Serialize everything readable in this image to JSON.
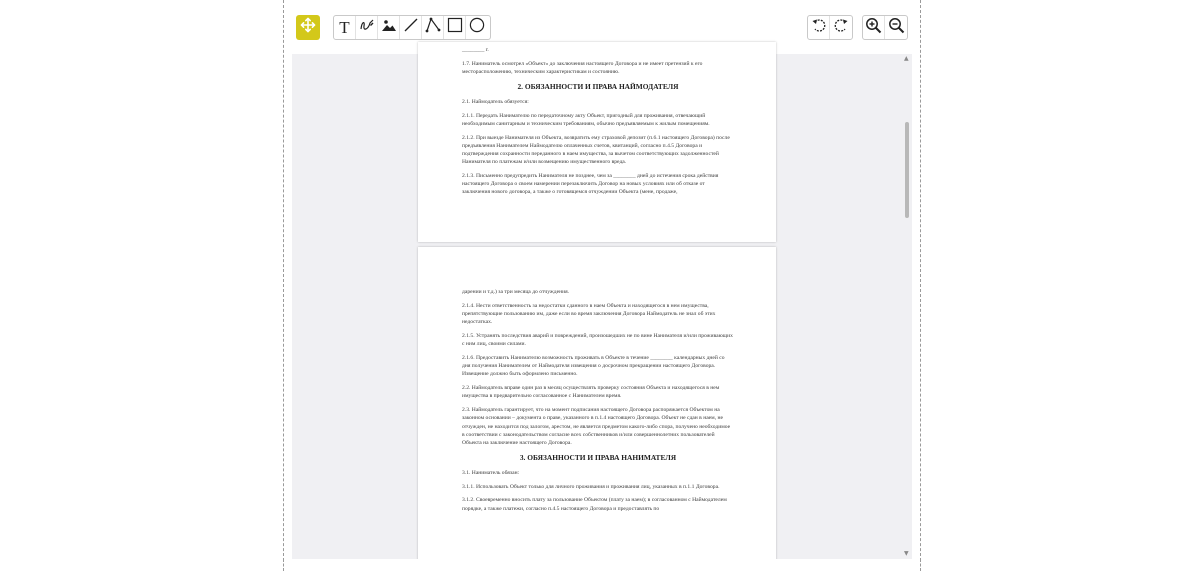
{
  "toolbar": {
    "move_tool": "move-icon",
    "tools": [
      "text-icon",
      "freehand-icon",
      "image-icon",
      "line-icon",
      "polyline-icon",
      "rectangle-icon",
      "circle-icon"
    ],
    "rotate": [
      "rotate-left-icon",
      "rotate-right-icon"
    ],
    "zoom": [
      "zoom-in-icon",
      "zoom-out-icon"
    ],
    "text_tool_label": "T",
    "accent_color": "#d3c81a"
  },
  "document": {
    "page1": {
      "top_fragment": "________ г.",
      "p_1_7": "1.7. Наниматель осмотрел «Объект» до заключения настоящего Договора и не имеет претензий к его месторасположению, техническим характеристикам и состоянию.",
      "heading_2": "2. ОБЯЗАННОСТИ И ПРАВА НАЙМОДАТЕЛЯ",
      "p_2_1": "2.1. Наймодатель обязуется:",
      "p_2_1_1": "2.1.1. Передать Нанимателю по передаточному акту Объект, пригодный для проживания, отвечающий необходимым санитарным и техническим требованиям, обычно предъявляемым к жилым помещениям.",
      "p_2_1_2": "2.1.2. При выезде Нанимателя из Объекта, возвратить ему страховой депозит (п.6.1 настоящего Договора) после предъявления Нанимателем Наймодателю оплаченных счетов, квитанций, согласно п.4.5 Договора и подтверждения сохранности переданного в наем имущества, за вычетом соответствующих задолженностей Нанимателя по платежам и/или возмещению имущественного вреда.",
      "p_2_1_3": "2.1.3. Письменно предупредить Нанимателя не позднее, чем за ________ дней до истечения срока действия настоящего Договора о своем намерении перезаключить Договор на новых условиях или об отказе от заключения нового договора, а также о готовящемся отчуждении Объекта (мене, продаже,"
    },
    "page2": {
      "p_cont": "дарении и т.д.) за три месяца до отчуждения.",
      "p_2_1_4": "2.1.4. Нести ответственность за недостатки сданного в наем Объекта и находящегося в нем имущества, препятствующие пользованию им, даже если во время заключения Договора Наймодатель не знал об этих недостатках.",
      "p_2_1_5": "2.1.5. Устранять последствия аварий и повреждений, произошедших не по вине Нанимателя и/или проживающих с ним лиц, своими силами.",
      "p_2_1_6": "2.1.6. Предоставить Нанимателю возможность проживать в Объекте в течение ________ календарных дней со дня получения Нанимателем от Наймодателя извещения о досрочном прекращении настоящего Договора. Извещение должно быть оформлено письменно.",
      "p_2_2": "2.2. Наймодатель вправе один раз в месяц осуществлять проверку состояния Объекта и находящегося в нем имущества в предварительно согласованное с Нанимателем время.",
      "p_2_3": "2.3. Наймодатель гарантирует, что на момент подписания настоящего Договора распоряжается Объектом на законном основании – документа о праве, указанного в п.1.4 настоящего Договора. Объект не сдан в наем, не отчужден, не находится под залогом, арестом, не является предметом какого-либо спора, получено необходимое в соответствии с законодательством согласие всех собственников и/или совершеннолетних пользователей Объекта на заключение настоящего Договора.",
      "heading_3": "3. ОБЯЗАННОСТИ И ПРАВА НАНИМАТЕЛЯ",
      "p_3_1": "3.1. Наниматель обязан:",
      "p_3_1_1": "3.1.1. Использовать Объект только для личного проживания и проживания лиц, указанных в п.1.1 Договора.",
      "p_3_1_2": "3.1.2. Своевременно вносить плату за пользование Объектом (плату за наем); в согласованном с Наймодателем порядке, а также платежи, согласно п.4.5 настоящего Договора и предоставлять по"
    }
  }
}
